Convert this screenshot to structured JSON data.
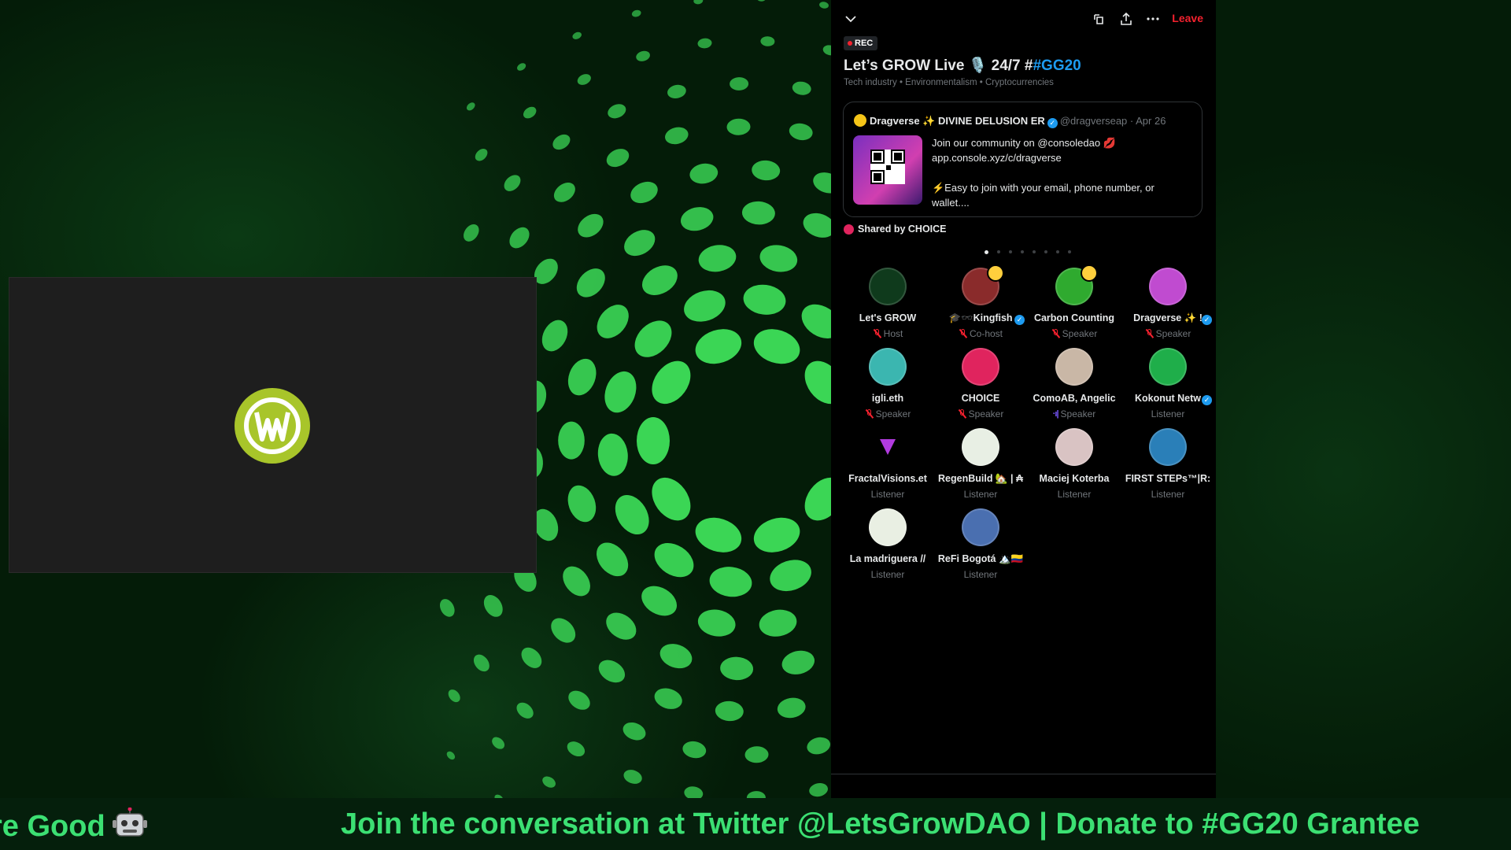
{
  "panel": {
    "leave_label": "Leave",
    "rec_label": "REC",
    "title_text": "Let’s GROW Live 🎙️ 24/7 #",
    "title_hashtag": "#GG20",
    "topics": "Tech industry • Environmentalism • Cryptocurrencies",
    "pinned": {
      "author": "Dragverse ✨ DIVINE DELUSION ER",
      "handle": "@dragverseap",
      "date": "Apr 26",
      "line1": "Join our community on @consoledao 💋",
      "line2": "app.console.xyz/c/dragverse",
      "line3": "⚡Easy to join with your email, phone number, or",
      "line4": "wallet...."
    },
    "shared_by": "Shared by CHOICE",
    "participants": [
      {
        "name": "Let's GROW",
        "role": "Host",
        "muted": true,
        "verified": false,
        "hand": false,
        "color": "#0f3a1c"
      },
      {
        "name": "🎓🕶️Kingfish",
        "role": "Co-host",
        "muted": true,
        "verified": true,
        "hand": true,
        "color": "#8a2b2b"
      },
      {
        "name": "Carbon Counting",
        "role": "Speaker",
        "muted": true,
        "verified": false,
        "hand": true,
        "color": "#2faa2f"
      },
      {
        "name": "Dragverse ✨ !",
        "role": "Speaker",
        "muted": true,
        "verified": true,
        "hand": false,
        "color": "#c04bd0"
      },
      {
        "name": "igli.eth",
        "role": "Speaker",
        "muted": true,
        "verified": false,
        "hand": false,
        "color": "#3bb6b0"
      },
      {
        "name": "CHOICE",
        "role": "Speaker",
        "muted": true,
        "verified": false,
        "hand": false,
        "color": "#e0245e"
      },
      {
        "name": "ComoAB, Angelic",
        "role": "Speaker",
        "muted": false,
        "speaking": true,
        "verified": false,
        "hand": false,
        "color": "#c9b7a6"
      },
      {
        "name": "Kokonut Netw",
        "role": "Listener",
        "muted": false,
        "verified": true,
        "hand": false,
        "color": "#1fae4a"
      },
      {
        "name": "FractalVisions.et",
        "role": "Listener",
        "muted": false,
        "verified": false,
        "hand": false,
        "color": "#000000"
      },
      {
        "name": "RegenBuild 🏡 | ₳",
        "role": "Listener",
        "muted": false,
        "verified": false,
        "hand": false,
        "color": "#e8efe4"
      },
      {
        "name": "Maciej Koterba",
        "role": "Listener",
        "muted": false,
        "verified": false,
        "hand": false,
        "color": "#d9c3c3"
      },
      {
        "name": "FIRST STEPs™|R:",
        "role": "Listener",
        "muted": false,
        "verified": false,
        "hand": false,
        "color": "#2a7fb8"
      },
      {
        "name": "La madriguera //",
        "role": "Listener",
        "muted": false,
        "verified": false,
        "hand": false,
        "color": "#e9efe3"
      },
      {
        "name": "ReFi Bogotá 🏔️🇨🇴",
        "role": "Listener",
        "muted": false,
        "verified": false,
        "hand": false,
        "color": "#4a6fb0"
      }
    ]
  },
  "ticker": {
    "left_text": "re Good",
    "main_text": "Join the conversation at Twitter @LetsGrowDAO | Donate to #GG20 Grantee"
  },
  "colors": {
    "accent": "#1d9bf0",
    "leave": "#f4212e",
    "ticker_text": "#3ce073",
    "brand_logo": "#a8c52a"
  }
}
